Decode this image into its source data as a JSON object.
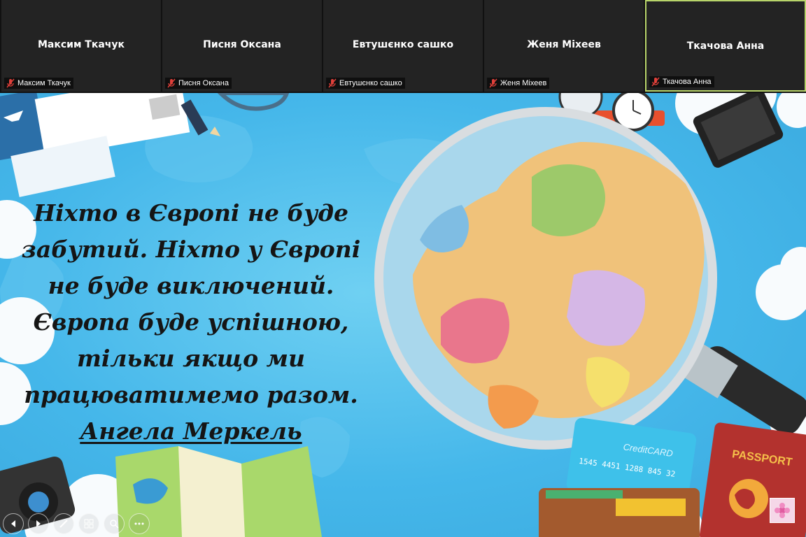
{
  "participants": [
    {
      "name": "Максим Ткачук",
      "label": "Максим Ткачук",
      "muted_icon": "mic-muted-icon"
    },
    {
      "name": "Писня Оксана",
      "label": "Писня Оксана",
      "muted_icon": "mic-muted-icon"
    },
    {
      "name": "Евтушєнко сашко",
      "label": "Евтушєнко сашко",
      "muted_icon": "mic-muted-icon"
    },
    {
      "name": "Женя Міхеев",
      "label": "Женя Міхеев",
      "muted_icon": "mic-muted-icon"
    },
    {
      "name": "Ткачова Анна",
      "label": "Ткачова Анна",
      "muted_icon": "mic-muted-icon",
      "active": true
    }
  ],
  "slide": {
    "quote_lines": "Ніхто в Європі не буде\nзабутий. Ніхто у Європі\nне буде виключений.\nЄвропа буде успішною,\nтільки якщо ми\nпрацюватимемо разом.",
    "author": "Ангела Меркель",
    "credit_card_label": "CreditCARD",
    "credit_card_number": "1545 4451 1288 845 32",
    "passport_label": "PASSPORT"
  },
  "controls": [
    "previous-slide-icon",
    "next-slide-icon",
    "pen-icon",
    "slides-grid-icon",
    "zoom-icon",
    "more-icon"
  ],
  "colors": {
    "active_border": "#b8d46a",
    "muted_icon": "#e0403a",
    "slide_bg": "#45b7ea"
  }
}
